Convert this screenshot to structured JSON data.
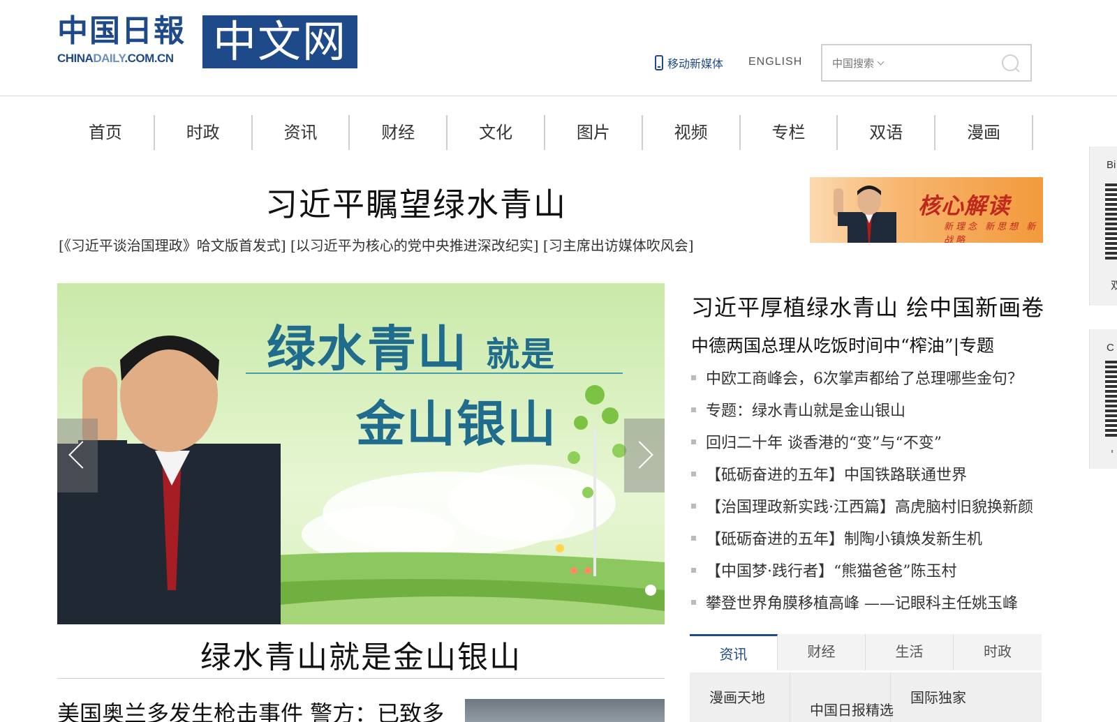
{
  "header": {
    "logo_cn": "中国日報",
    "logo_en_a": "CHINA",
    "logo_en_b": "DAILY",
    "logo_en_c": ".COM.CN",
    "logo_zw": "中文网",
    "mobile_label": "移动新媒体",
    "english_label": "ENGLISH",
    "search_scope": "中国搜索",
    "search_placeholder": ""
  },
  "nav": {
    "items": [
      "首页",
      "时政",
      "资讯",
      "财经",
      "文化",
      "图片",
      "视频",
      "专栏",
      "双语",
      "漫画"
    ]
  },
  "top": {
    "headline": "习近平瞩望绿水青山",
    "sublinks": "[《习近平谈治国理政》哈文版首发式] [以习近平为核心的党中央推进深改纪实] [习主席出访媒体吹风会]",
    "banner_title": "核心解读",
    "banner_sub": "新理念 新思想 新战略"
  },
  "slider": {
    "line1": "绿水青山",
    "line1_small": "就是",
    "line2": "金山银山",
    "caption": "绿水青山就是金山银山"
  },
  "bottom_story": "美国奥兰多发生枪击事件 警方：已致多",
  "right": {
    "headline": "习近平厚植绿水青山 绘中国新画卷",
    "sub": "中德两国总理从吃饭时间中“榨油”|专题",
    "news": [
      "中欧工商峰会，6次掌声都给了总理哪些金句？",
      "专题：绿水青山就是金山银山",
      "回归二十年 谈香港的“变”与“不变”",
      "【砥砺奋进的五年】中国铁路联通世界",
      "【治国理政新实践·江西篇】高虎脑村旧貌换新颜",
      "【砥砺奋进的五年】制陶小镇焕发新生机",
      "【中国梦·践行者】“熊猫爸爸”陈玉村",
      "攀登世界角膜移植高峰 ——记眼科主任姚玉峰"
    ]
  },
  "tabs": {
    "items": [
      "资讯",
      "财经",
      "生活",
      "时政"
    ],
    "sub": [
      "漫画天地",
      "中国日报精选",
      "国际独家"
    ]
  },
  "side_widgets": {
    "w1_label": "Bi",
    "w1_bottom": "双",
    "w2_label": "C",
    "w2_bottom": "'"
  },
  "colors": {
    "brand": "#1f4a8a",
    "banner_red": "#c0281e"
  }
}
